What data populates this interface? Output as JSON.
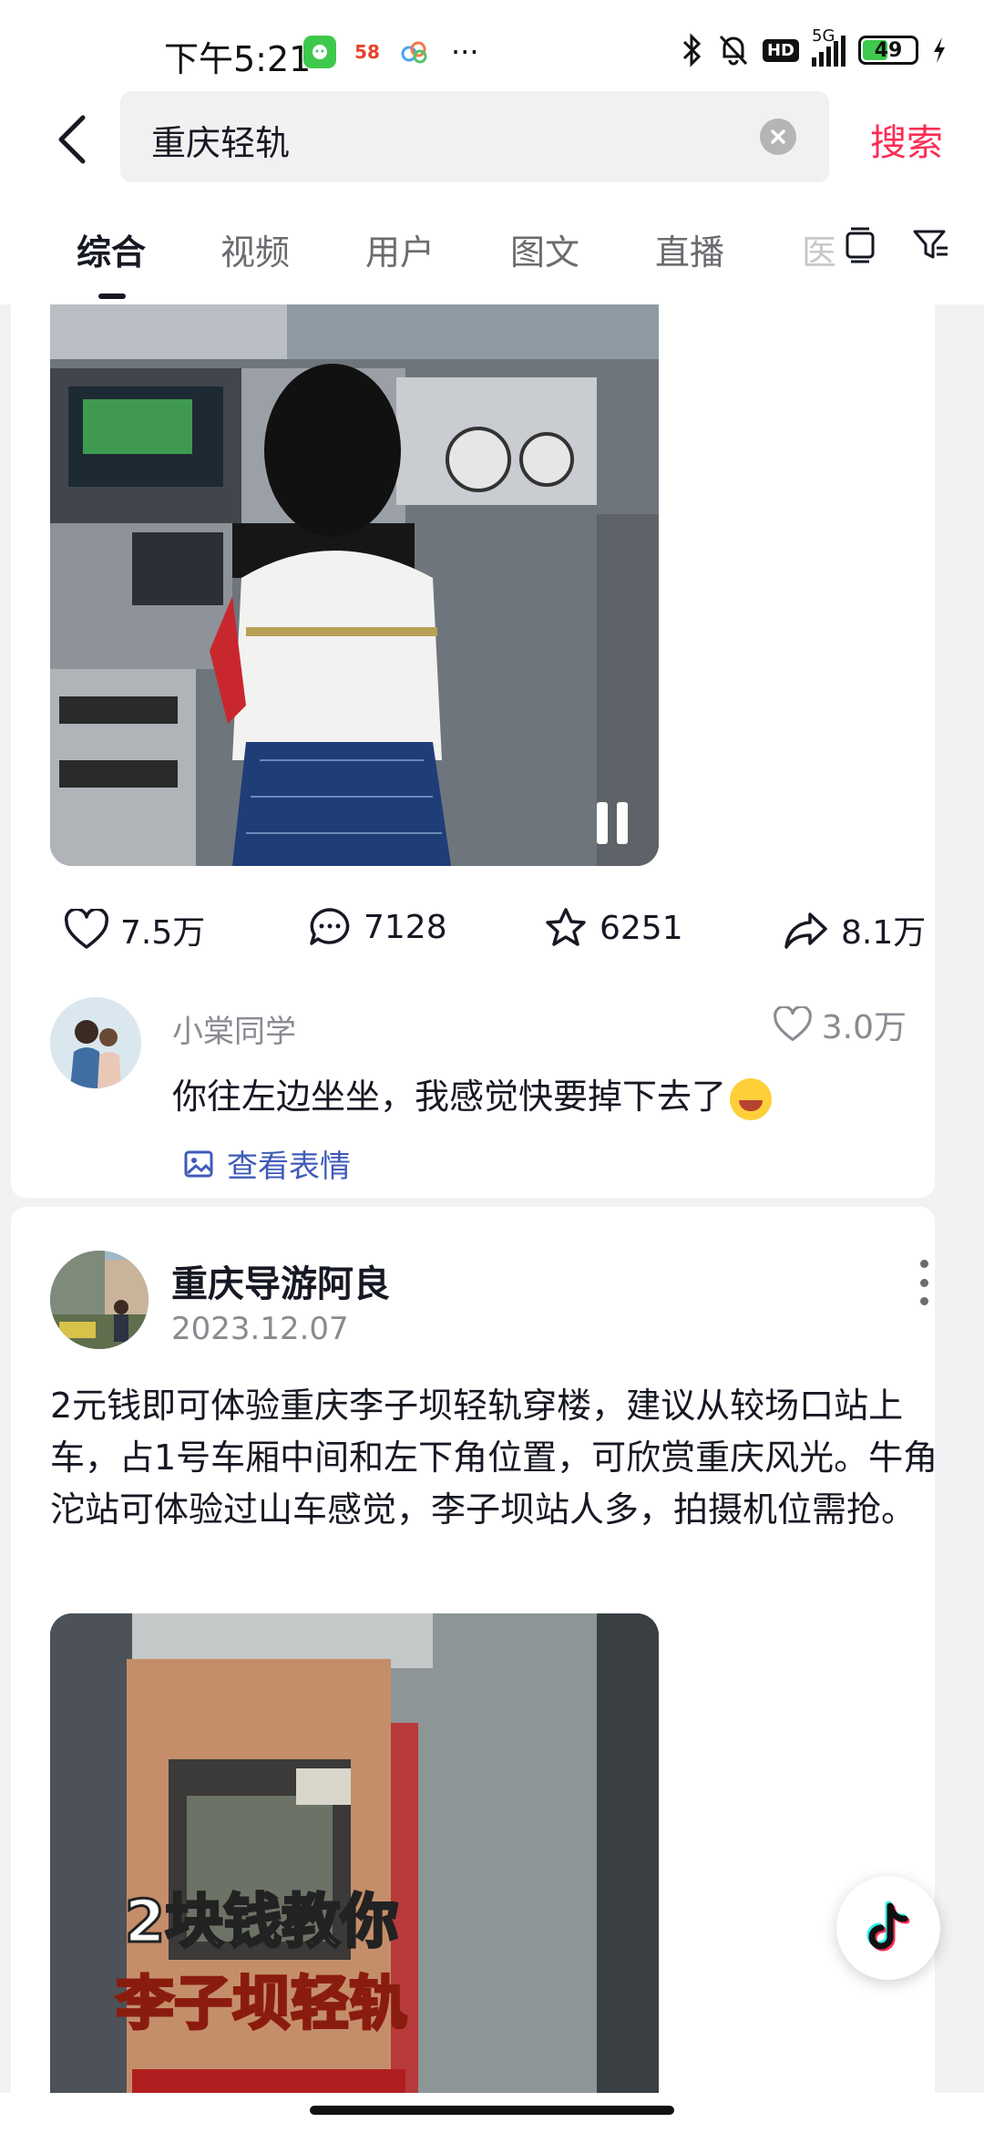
{
  "status_bar": {
    "time": "下午5:21",
    "app_badge_58": "58",
    "more": "···",
    "hd": "HD",
    "network": "5G",
    "battery": "49"
  },
  "search": {
    "query": "重庆轻轨",
    "submit_label": "搜索"
  },
  "tabs": [
    "综合",
    "视频",
    "用户",
    "图文",
    "直播"
  ],
  "tab_overflow": "医",
  "colors": {
    "accent": "#fe2c55",
    "text": "#161823",
    "secondary": "#8a8b91",
    "link": "#3f5bb8"
  },
  "post1": {
    "likes": "7.5万",
    "comments": "7128",
    "favorites": "6251",
    "shares": "8.1万",
    "top_comment": {
      "user": "小棠同学",
      "likes": "3.0万",
      "text": "你往左边坐坐，我感觉快要掉下去了",
      "sticker_link": "查看表情"
    }
  },
  "post2": {
    "author": "重庆导游阿良",
    "date": "2023.12.07",
    "text": "2元钱即可体验重庆李子坝轻轨穿楼，建议从较场口站上车，占1号车厢中间和左下角位置，可欣赏重庆风光。牛角沱站可体验过山车感觉，李子坝站人多，拍摄机位需抢。",
    "cover_caption_1": "2块钱教你",
    "cover_caption_2": "李子坝轻轨"
  }
}
